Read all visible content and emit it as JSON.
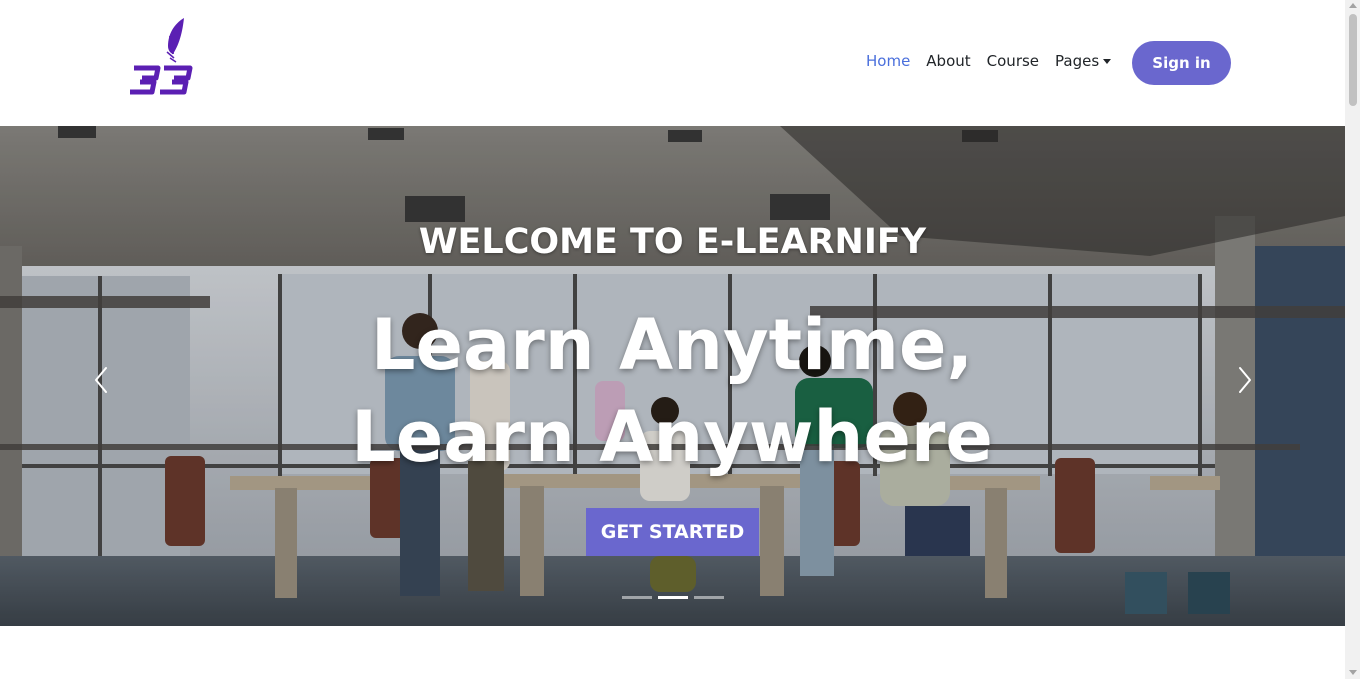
{
  "nav": {
    "items": [
      {
        "label": "Home"
      },
      {
        "label": "About"
      },
      {
        "label": "Course"
      },
      {
        "label": "Pages"
      }
    ],
    "signin_label": "Sign in"
  },
  "hero": {
    "welcome": "WELCOME TO E-LEARNIFY",
    "headline": "Learn Anytime, Learn Anywhere",
    "cta_label": "GET STARTED",
    "slide_count": 3,
    "active_slide": 2
  },
  "colors": {
    "accent": "#6a67ce",
    "active_link": "#4a6fdc",
    "logo": "#5b1fb3"
  },
  "icons": {
    "logo": "quill-logo-icon",
    "prev": "chevron-left-icon",
    "next": "chevron-right-icon",
    "dropdown": "caret-down-icon"
  }
}
